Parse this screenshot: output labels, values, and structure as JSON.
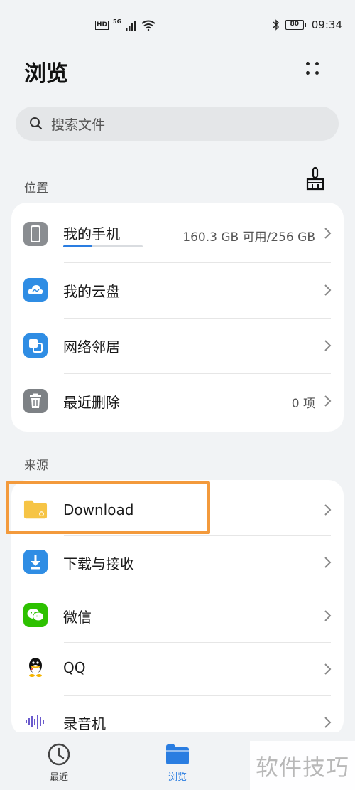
{
  "status_bar": {
    "hd": "HD",
    "network": "5G",
    "battery": "80",
    "time": "09:34"
  },
  "header": {
    "title": "浏览",
    "more_icon": "more-dots-icon"
  },
  "search": {
    "placeholder": "搜索文件"
  },
  "location_section": {
    "label": "位置",
    "items": [
      {
        "label": "我的手机",
        "value": "160.3 GB 可用/256 GB",
        "icon": "phone-icon",
        "storage_used_fraction": 0.37
      },
      {
        "label": "我的云盘",
        "value": "",
        "icon": "cloud-icon"
      },
      {
        "label": "网络邻居",
        "value": "",
        "icon": "network-icon"
      },
      {
        "label": "最近删除",
        "value": "0 项",
        "icon": "trash-icon"
      }
    ]
  },
  "source_section": {
    "label": "来源",
    "items": [
      {
        "label": "Download",
        "icon": "folder-icon"
      },
      {
        "label": "下载与接收",
        "icon": "download-icon"
      },
      {
        "label": "微信",
        "icon": "wechat-icon"
      },
      {
        "label": "QQ",
        "icon": "qq-icon"
      },
      {
        "label": "录音机",
        "icon": "recorder-icon"
      }
    ]
  },
  "bottom_nav": {
    "items": [
      {
        "label": "最近",
        "icon": "clock-icon",
        "active": false
      },
      {
        "label": "浏览",
        "icon": "folder-icon",
        "active": true
      }
    ]
  },
  "watermark": "软件技巧",
  "colors": {
    "accent": "#2a7de1",
    "highlight": "#f39a3c",
    "background": "#f1f3f5"
  }
}
